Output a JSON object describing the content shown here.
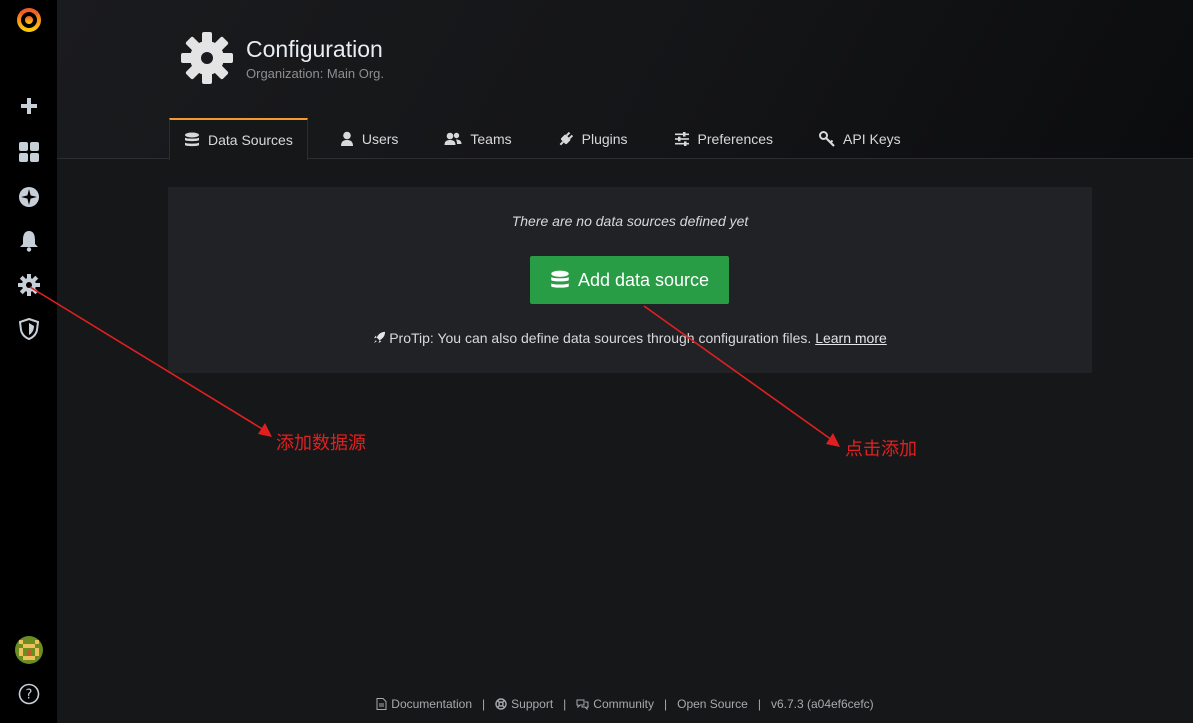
{
  "header": {
    "title": "Configuration",
    "subtitle": "Organization: Main Org."
  },
  "tabs": [
    {
      "label": "Data Sources",
      "icon": "database-icon",
      "active": true
    },
    {
      "label": "Users",
      "icon": "user-icon"
    },
    {
      "label": "Teams",
      "icon": "users-icon"
    },
    {
      "label": "Plugins",
      "icon": "plug-icon"
    },
    {
      "label": "Preferences",
      "icon": "sliders-icon"
    },
    {
      "label": "API Keys",
      "icon": "key-icon"
    }
  ],
  "panel": {
    "empty_message": "There are no data sources defined yet",
    "add_button": "Add data source",
    "protip_text": "ProTip: You can also define data sources through configuration files.",
    "protip_link": "Learn more"
  },
  "sidebar": {
    "items": [
      "grafana-logo-icon",
      "plus-icon",
      "apps-icon",
      "compass-icon",
      "bell-icon",
      "gear-icon",
      "shield-icon",
      "avatar",
      "help-icon"
    ]
  },
  "annotations": {
    "left_label": "添加数据源",
    "right_label": "点击添加",
    "color": "#e02020"
  },
  "footer": {
    "documentation": "Documentation",
    "support": "Support",
    "community": "Community",
    "open_source": "Open Source",
    "version": "v6.7.3 (a04ef6cefc)",
    "separator": "|"
  },
  "colors": {
    "accent": "#f59a2d",
    "primary_button": "#299c46",
    "background": "#161719"
  }
}
